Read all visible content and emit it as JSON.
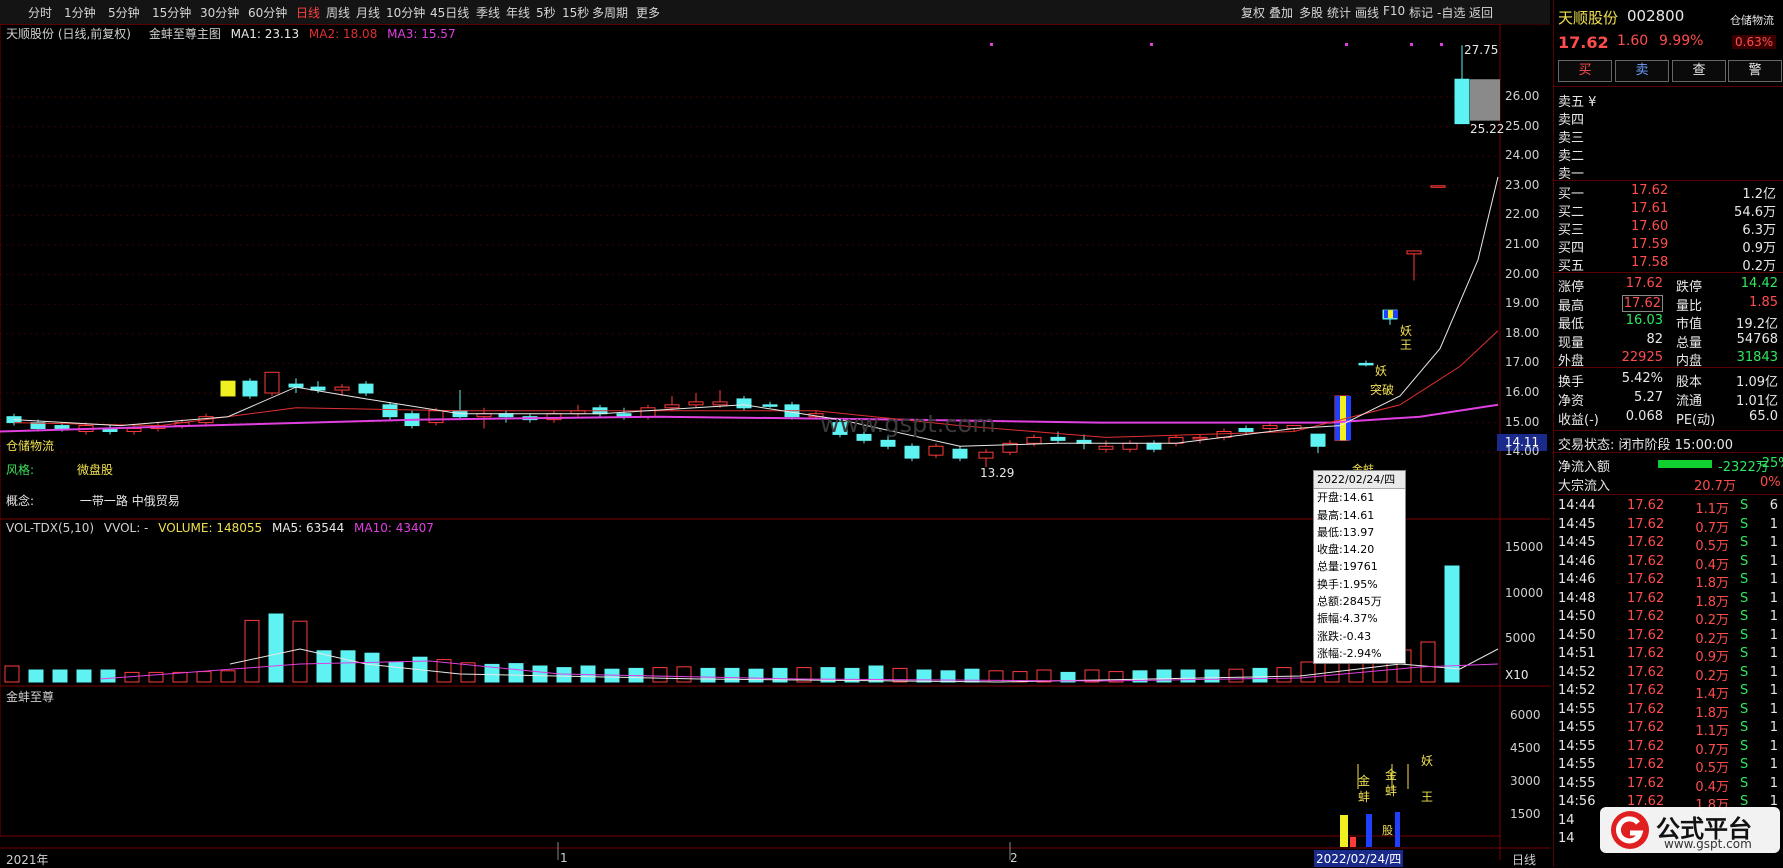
{
  "toolbar": {
    "periods": [
      "分时",
      "1分钟",
      "5分钟",
      "15分钟",
      "30分钟",
      "60分钟",
      "日线",
      "周线",
      "月线",
      "10分钟",
      "45日线",
      "季线",
      "年线",
      "5秒",
      "15秒",
      "多周期",
      "更多"
    ],
    "active_period": "日线",
    "tools": [
      "复权",
      "叠加",
      "多股",
      "统计",
      "画线",
      "F10",
      "标记",
      "-自选",
      "返回"
    ]
  },
  "main_legend": {
    "stock": "天顺股份 (日线,前复权)",
    "indicator": "金蚌至尊主图",
    "ma1": "MA1: 23.13",
    "ma2": "MA2: 18.08",
    "ma3": "MA3: 15.57",
    "colors": {
      "ma1": "#e8e8e8",
      "ma2": "#e03030",
      "ma3": "#e040e0"
    }
  },
  "main_labels": {
    "concept_label": "概念:",
    "concept_value": "一带一路 中俄贸易",
    "sector_tag": "仓储物流",
    "style_tag": "风格:",
    "style_value": "微盘股",
    "high_price": "27.75",
    "peak_low": "25.22",
    "low_price": "13.29",
    "current_price": "14.11",
    "breakout_label": "突破",
    "yao_label_1": "妖",
    "wang_label_1": "王",
    "yao_label_2": "妖",
    "wang_label_2": "王",
    "jinbang_label": "金蚌",
    "watermark": "www.gspt.com"
  },
  "price_axis": [
    "26.00",
    "25.00",
    "24.00",
    "23.00",
    "22.00",
    "21.00",
    "20.00",
    "19.00",
    "18.00",
    "17.00",
    "16.00",
    "15.00",
    "14.00"
  ],
  "vol_legend": {
    "name": "VOL-TDX(5,10)",
    "vvol": "VVOL: -",
    "volume": "VOLUME: 148055",
    "ma5": "MA5: 63544",
    "ma10": "MA10: 43407"
  },
  "vol_axis": [
    "15000",
    "10000",
    "5000"
  ],
  "vol_unit": "X10",
  "ind_legend": {
    "name": "金蚌至尊"
  },
  "ind_axis": [
    "6000",
    "4500",
    "3000",
    "1500"
  ],
  "ind_labels": {
    "jin1": "金",
    "bang1": "蚌",
    "jin2": "金",
    "bang2": "蚌",
    "yao": "妖",
    "wang": "王",
    "gu": "股"
  },
  "date_axis": {
    "start": "2021年",
    "m1": "1",
    "m2": "2",
    "cursor": "2022/02/24/四",
    "period": "日线"
  },
  "tooltip": {
    "date": "2022/02/24/四",
    "open": "开盘:14.61",
    "high": "最高:14.61",
    "low": "最低:13.97",
    "close": "收盘:14.20",
    "volume": "总量:19761",
    "turnover": "换手:1.95%",
    "amount": "总额:2845万",
    "amplitude": "振幅:4.37%",
    "change": "涨跌:-0.43",
    "pct": "涨幅:-2.94%"
  },
  "quote": {
    "name": "天顺股份",
    "code": "002800",
    "sector": "仓储物流",
    "price": "17.62",
    "change": "1.60",
    "pct": "9.99%",
    "sector_pct": "0.63%",
    "buttons": [
      "买",
      "卖",
      "查",
      "警"
    ],
    "ask": [
      "卖五 ¥",
      "卖四",
      "卖三",
      "卖二",
      "卖一"
    ],
    "bid": [
      {
        "label": "买一",
        "price": "17.62",
        "vol": "1.2亿"
      },
      {
        "label": "买二",
        "price": "17.61",
        "vol": "54.6万"
      },
      {
        "label": "买三",
        "price": "17.60",
        "vol": "6.3万"
      },
      {
        "label": "买四",
        "price": "17.59",
        "vol": "0.9万"
      },
      {
        "label": "买五",
        "price": "17.58",
        "vol": "0.2万"
      }
    ],
    "stats": [
      {
        "l": "涨停",
        "v": "17.62",
        "l2": "跌停",
        "v2": "14.42"
      },
      {
        "l": "最高",
        "v": "17.62",
        "l2": "量比",
        "v2": "1.85"
      },
      {
        "l": "最低",
        "v": "16.03",
        "l2": "市值",
        "v2": "19.2亿"
      },
      {
        "l": "现量",
        "v": "82",
        "l2": "总量",
        "v2": "54768"
      },
      {
        "l": "外盘",
        "v": "22925",
        "l2": "内盘",
        "v2": "31843"
      }
    ],
    "stats2": [
      {
        "l": "换手",
        "v": "5.42%",
        "l2": "股本",
        "v2": "1.09亿"
      },
      {
        "l": "净资",
        "v": "5.27",
        "l2": "流通",
        "v2": "1.01亿"
      },
      {
        "l": "收益(-)",
        "v": "0.068",
        "l2": "PE(动)",
        "v2": "65.0"
      }
    ],
    "trade_status": "交易状态: 闭市阶段 15:00:00",
    "net_inflow_label": "净流入额",
    "net_inflow_value": "-2322万",
    "net_inflow_pct": "-25%",
    "block_label": "大宗流入",
    "block_value": "20.7万",
    "block_pct": "0%"
  },
  "ticks": [
    {
      "t": "14:44",
      "p": "17.62",
      "v": "1.1万",
      "s": "S",
      "n": "6"
    },
    {
      "t": "14:45",
      "p": "17.62",
      "v": "0.7万",
      "s": "S",
      "n": "1"
    },
    {
      "t": "14:45",
      "p": "17.62",
      "v": "0.5万",
      "s": "S",
      "n": "1"
    },
    {
      "t": "14:46",
      "p": "17.62",
      "v": "0.4万",
      "s": "S",
      "n": "1"
    },
    {
      "t": "14:46",
      "p": "17.62",
      "v": "1.8万",
      "s": "S",
      "n": "1"
    },
    {
      "t": "14:48",
      "p": "17.62",
      "v": "1.8万",
      "s": "S",
      "n": "1"
    },
    {
      "t": "14:50",
      "p": "17.62",
      "v": "0.2万",
      "s": "S",
      "n": "1"
    },
    {
      "t": "14:50",
      "p": "17.62",
      "v": "0.2万",
      "s": "S",
      "n": "1"
    },
    {
      "t": "14:51",
      "p": "17.62",
      "v": "0.9万",
      "s": "S",
      "n": "1"
    },
    {
      "t": "14:52",
      "p": "17.62",
      "v": "0.2万",
      "s": "S",
      "n": "1"
    },
    {
      "t": "14:52",
      "p": "17.62",
      "v": "1.4万",
      "s": "S",
      "n": "1"
    },
    {
      "t": "14:55",
      "p": "17.62",
      "v": "1.8万",
      "s": "S",
      "n": "1"
    },
    {
      "t": "14:55",
      "p": "17.62",
      "v": "1.1万",
      "s": "S",
      "n": "1"
    },
    {
      "t": "14:55",
      "p": "17.62",
      "v": "0.7万",
      "s": "S",
      "n": "1"
    },
    {
      "t": "14:55",
      "p": "17.62",
      "v": "0.5万",
      "s": "S",
      "n": "1"
    },
    {
      "t": "14:55",
      "p": "17.62",
      "v": "0.4万",
      "s": "S",
      "n": "1"
    },
    {
      "t": "14:56",
      "p": "17.62",
      "v": "1.8万",
      "s": "S",
      "n": "1"
    },
    {
      "t": "14",
      "p": "",
      "v": "",
      "s": "",
      "n": ""
    },
    {
      "t": "14",
      "p": "",
      "v": "",
      "s": "",
      "n": ""
    }
  ],
  "logo": {
    "text": "公式平台",
    "url_text": "www.gspt.com",
    "icon": "g-logo-icon"
  }
}
